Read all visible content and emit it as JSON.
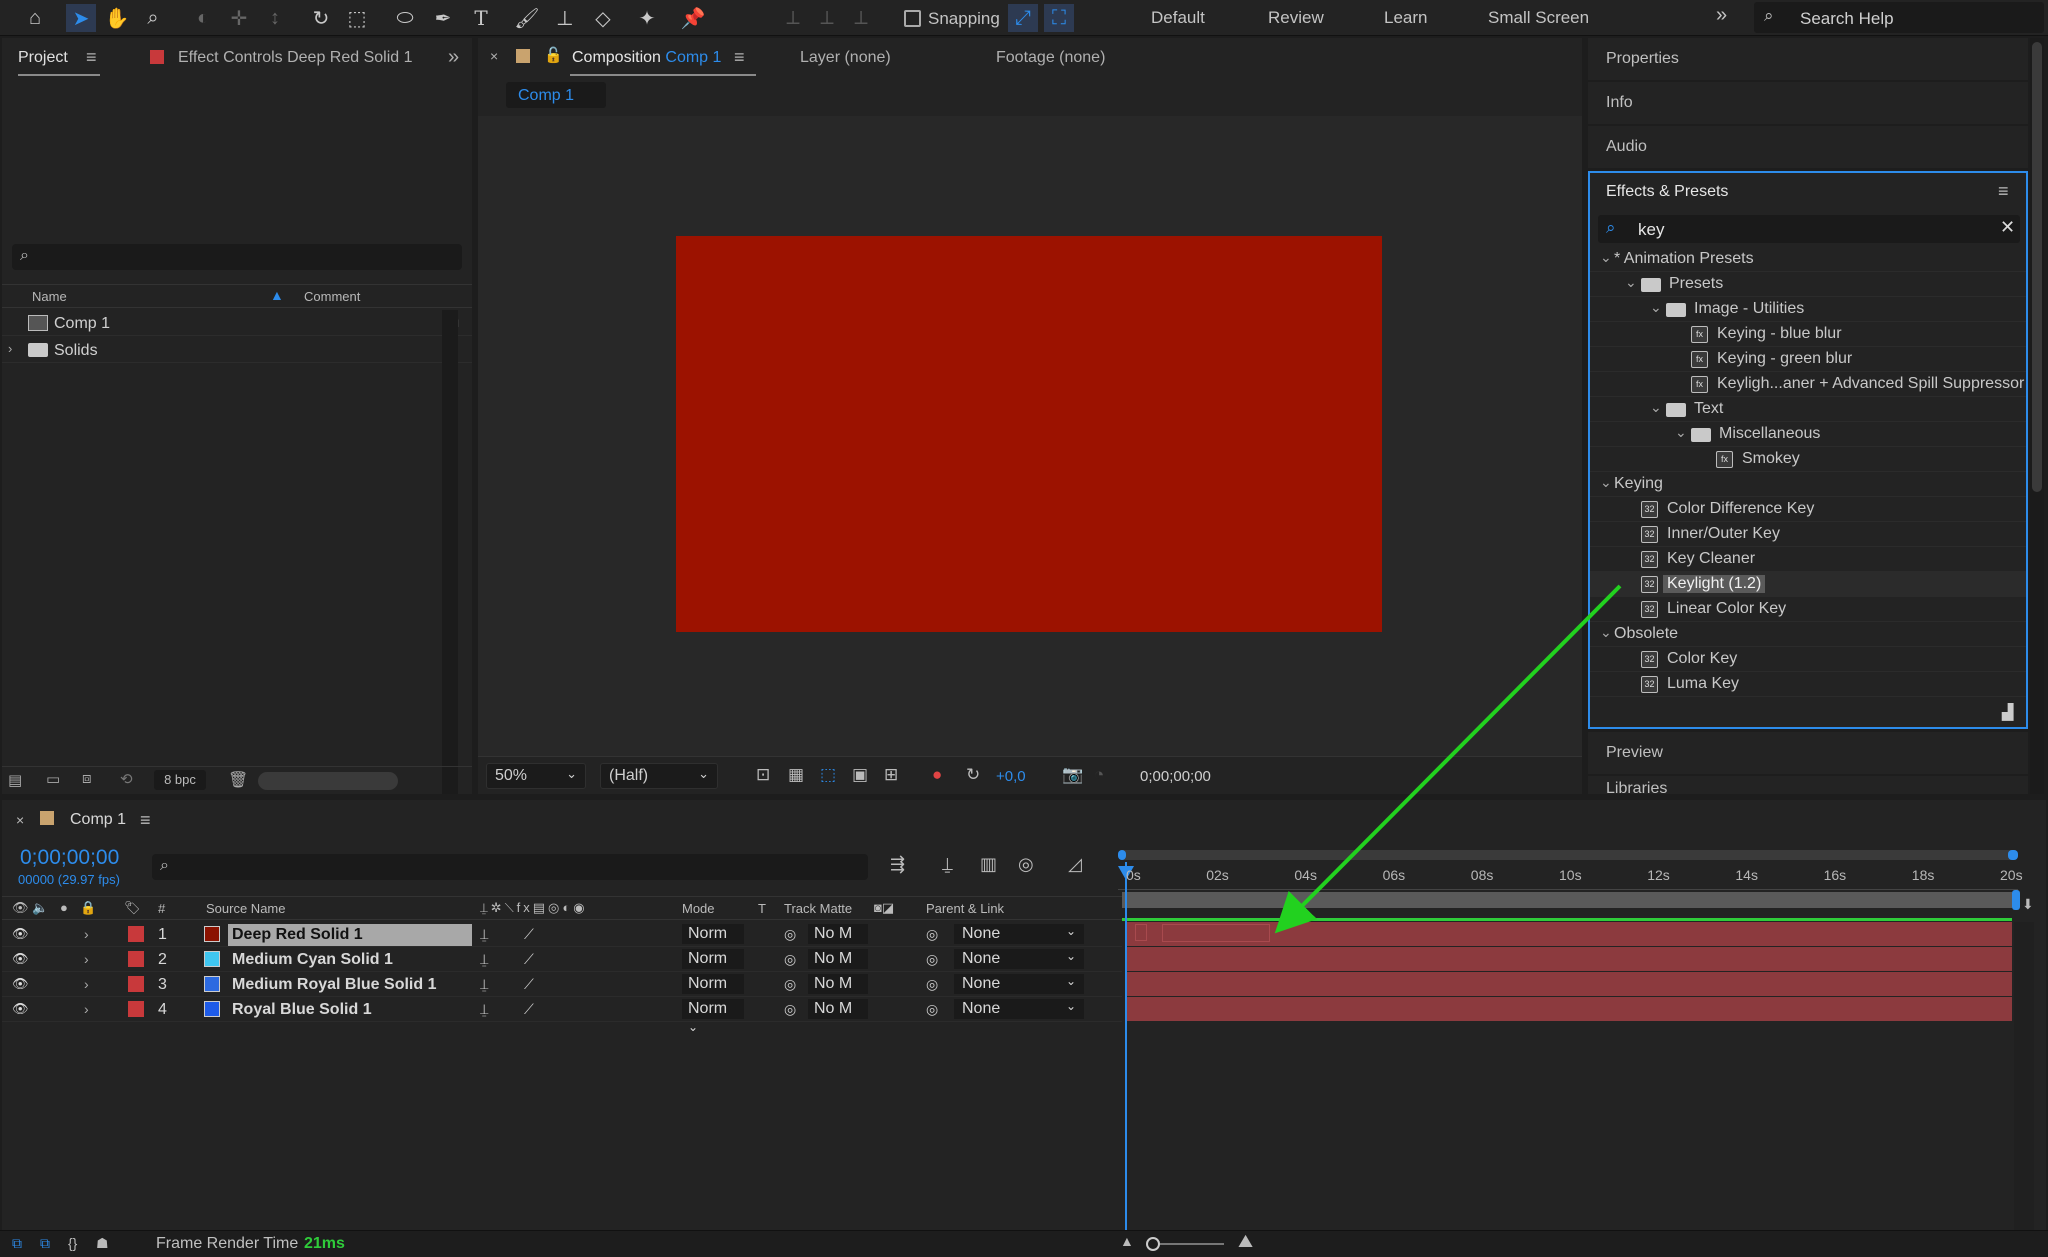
{
  "toolbar": {
    "snapping_label": "Snapping",
    "workspaces": [
      "Default",
      "Review",
      "Learn",
      "Small Screen"
    ],
    "search_placeholder": "Search Help"
  },
  "project": {
    "tab_label": "Project",
    "effect_controls_label": "Effect Controls Deep Red Solid 1",
    "col_name": "Name",
    "col_comment": "Comment",
    "items": [
      {
        "name": "Comp 1",
        "type": "composition"
      },
      {
        "name": "Solids",
        "type": "folder"
      }
    ],
    "bpc_label": "8 bpc"
  },
  "viewer": {
    "tab_prefix": "Composition",
    "tab_comp": "Comp 1",
    "layer_tab": "Layer (none)",
    "footage_tab": "Footage (none)",
    "breadcrumb": "Comp 1",
    "solid_color": "#9c1200",
    "zoom": "50%",
    "resolution": "(Half)",
    "exposure": "+0,0",
    "timecode": "0;00;00;00"
  },
  "right": {
    "properties": "Properties",
    "info": "Info",
    "audio": "Audio",
    "effects_title": "Effects & Presets",
    "search_value": "key",
    "tree": [
      {
        "label": "* Animation Presets",
        "level": 0,
        "kind": "root"
      },
      {
        "label": "Presets",
        "level": 1,
        "kind": "folder"
      },
      {
        "label": "Image - Utilities",
        "level": 2,
        "kind": "folder"
      },
      {
        "label": "Keying - blue blur",
        "level": 3,
        "kind": "preset"
      },
      {
        "label": "Keying - green blur",
        "level": 3,
        "kind": "preset"
      },
      {
        "label": "Keyligh...aner + Advanced Spill Suppressor",
        "level": 3,
        "kind": "preset"
      },
      {
        "label": "Text",
        "level": 2,
        "kind": "folder"
      },
      {
        "label": "Miscellaneous",
        "level": 3,
        "kind": "folder"
      },
      {
        "label": "Smokey",
        "level": 4,
        "kind": "preset"
      },
      {
        "label": "Keying",
        "level": 0,
        "kind": "root"
      },
      {
        "label": "Color Difference Key",
        "level": 1,
        "kind": "effect"
      },
      {
        "label": "Inner/Outer Key",
        "level": 1,
        "kind": "effect"
      },
      {
        "label": "Key Cleaner",
        "level": 1,
        "kind": "effect"
      },
      {
        "label": "Keylight (1.2)",
        "level": 1,
        "kind": "effect",
        "selected": true
      },
      {
        "label": "Linear Color Key",
        "level": 1,
        "kind": "effect"
      },
      {
        "label": "Obsolete",
        "level": 0,
        "kind": "root"
      },
      {
        "label": "Color Key",
        "level": 1,
        "kind": "effect"
      },
      {
        "label": "Luma Key",
        "level": 1,
        "kind": "effect"
      }
    ],
    "preview": "Preview",
    "libraries": "Libraries"
  },
  "timeline": {
    "tab_label": "Comp 1",
    "timecode": "0;00;00;00",
    "frames": "00000 (29.97 fps)",
    "headers": {
      "source_name": "Source Name",
      "mode": "Mode",
      "t": "T",
      "track_matte": "Track Matte",
      "parent": "Parent & Link"
    },
    "ticks": [
      "0s",
      "02s",
      "04s",
      "06s",
      "08s",
      "10s",
      "12s",
      "14s",
      "16s",
      "18s",
      "20s"
    ],
    "layers": [
      {
        "num": "1",
        "name": "Deep Red Solid 1",
        "color": "#8b1200",
        "mode": "Norm",
        "matte": "No M",
        "parent": "None",
        "selected": true
      },
      {
        "num": "2",
        "name": "Medium Cyan Solid 1",
        "color": "#3fc6f0",
        "mode": "Norm",
        "matte": "No M",
        "parent": "None"
      },
      {
        "num": "3",
        "name": "Medium Royal Blue Solid 1",
        "color": "#2c6ae0",
        "mode": "Norm",
        "matte": "No M",
        "parent": "None"
      },
      {
        "num": "4",
        "name": "Royal Blue Solid 1",
        "color": "#1e5be8",
        "mode": "Norm",
        "matte": "No M",
        "parent": "None"
      }
    ]
  },
  "status": {
    "frame_render_label": "Frame Render Time",
    "frame_render_value": "21ms"
  },
  "colors": {
    "accent": "#2d8ceb",
    "label_red": "#c8393b",
    "annotation_arrow": "#22d11f"
  }
}
